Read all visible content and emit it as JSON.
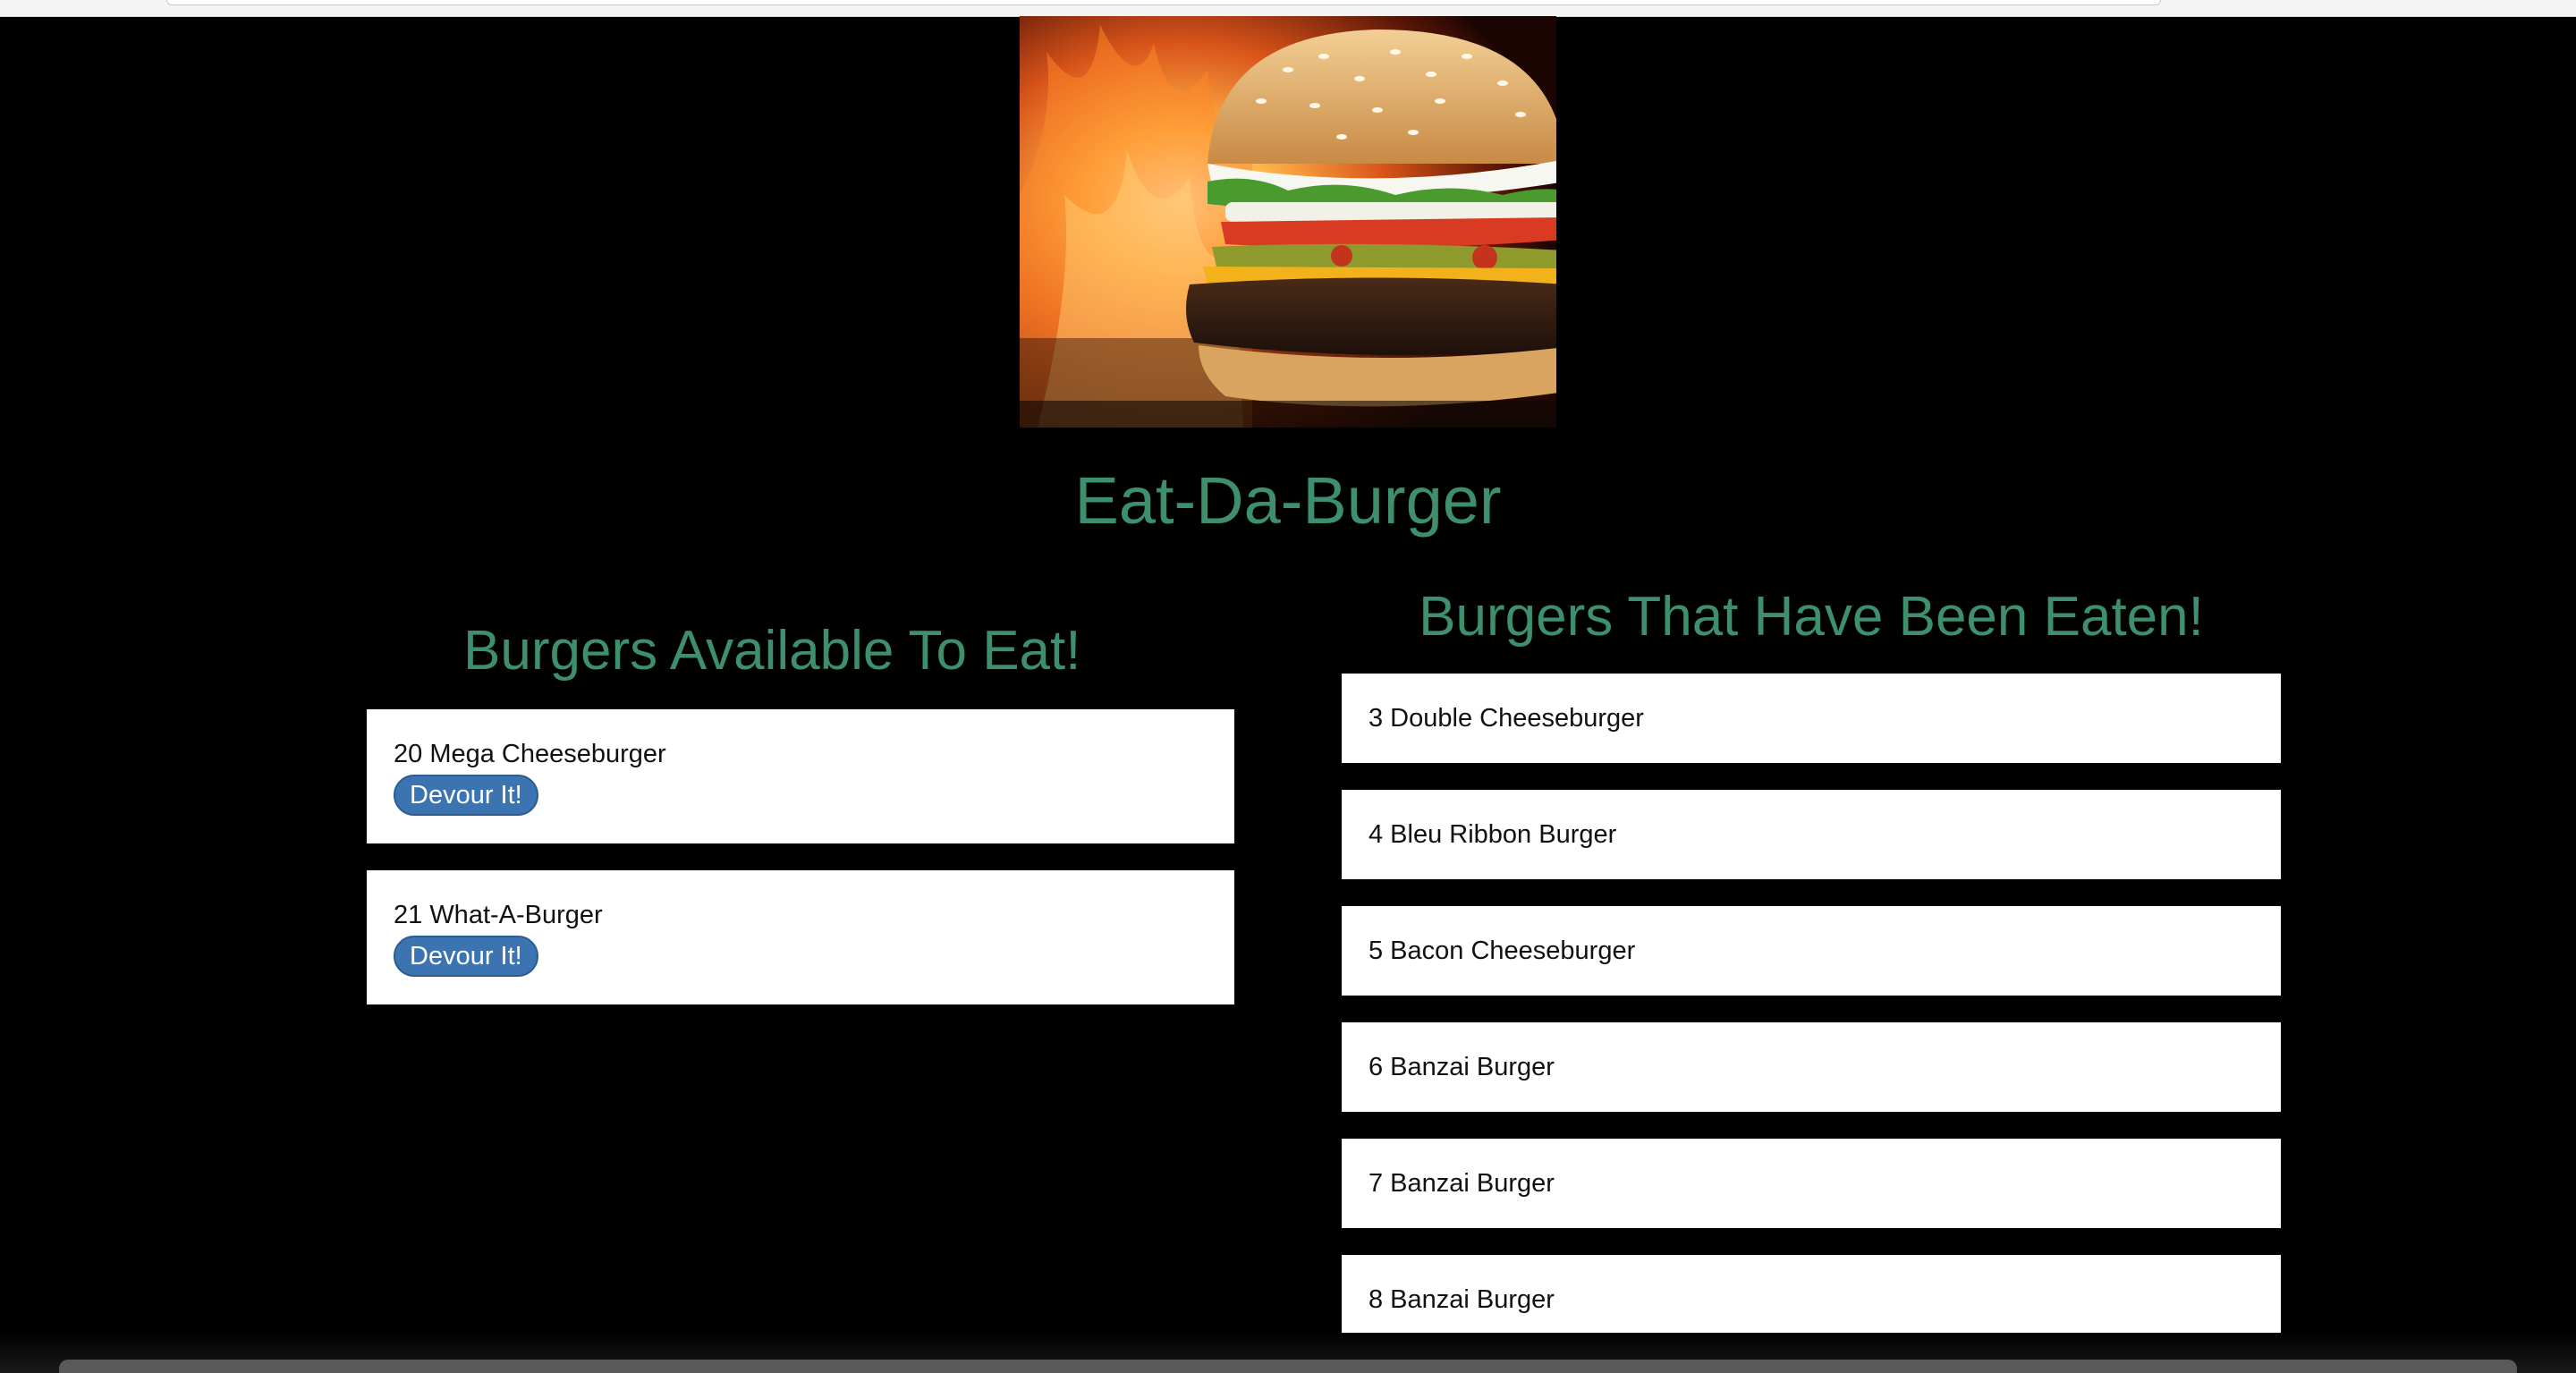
{
  "page": {
    "title": "Eat-Da-Burger"
  },
  "hero": {
    "icon": "burger-photo"
  },
  "available": {
    "heading": "Burgers Available To Eat!",
    "items": [
      {
        "label": "20 Mega Cheeseburger",
        "button": "Devour It!"
      },
      {
        "label": "21 What-A-Burger",
        "button": "Devour It!"
      }
    ]
  },
  "eaten": {
    "heading": "Burgers That Have Been Eaten!",
    "items": [
      {
        "label": "3 Double Cheeseburger"
      },
      {
        "label": "4 Bleu Ribbon Burger"
      },
      {
        "label": "5 Bacon Cheeseburger"
      },
      {
        "label": "6 Banzai Burger"
      },
      {
        "label": "7 Banzai Burger"
      },
      {
        "label": "8 Banzai Burger"
      }
    ]
  },
  "colors": {
    "background": "#000000",
    "heading": "#3e8f6e",
    "button": "#3b74b1",
    "card": "#ffffff"
  }
}
